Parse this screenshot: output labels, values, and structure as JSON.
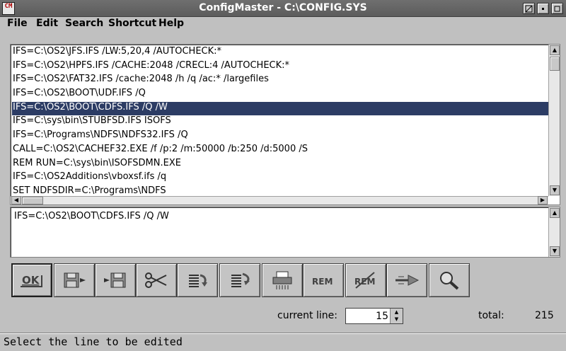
{
  "window": {
    "title": "ConfigMaster - C:\\CONFIG.SYS",
    "app_icon_text": "CM"
  },
  "menu": {
    "items": [
      "File",
      "Edit",
      "Search",
      "Shortcut",
      "Help"
    ]
  },
  "list": {
    "lines": [
      "IFS=C:\\OS2\\JFS.IFS /LW:5,20,4 /AUTOCHECK:*",
      "IFS=C:\\OS2\\HPFS.IFS /CACHE:2048 /CRECL:4 /AUTOCHECK:*",
      "IFS=C:\\OS2\\FAT32.IFS /cache:2048 /h /q /ac:* /largefiles",
      "IFS=C:\\OS2\\BOOT\\UDF.IFS /Q",
      "IFS=C:\\OS2\\BOOT\\CDFS.IFS /Q /W",
      "IFS=C:\\sys\\bin\\STUBFSD.IFS ISOFS",
      "IFS=C:\\Programs\\NDFS\\NDFS32.IFS /Q",
      "CALL=C:\\OS2\\CACHEF32.EXE /f /p:2 /m:50000 /b:250 /d:5000 /S",
      "REM RUN=C:\\sys\\bin\\ISOFSDMN.EXE",
      "IFS=C:\\OS2Additions\\vboxsf.ifs /q",
      "SET NDFSDIR=C:\\Programs\\NDFS"
    ],
    "selected_index": 4
  },
  "editor": {
    "text": "IFS=C:\\OS2\\BOOT\\CDFS.IFS /Q /W"
  },
  "toolbar": {
    "ok_label": "OK",
    "rem_label": "REM",
    "unrem_label": "REM"
  },
  "footer": {
    "current_line_label": "current line:",
    "current_line_value": "15",
    "total_label": "total:",
    "total_value": "215"
  },
  "status": {
    "text": "Select the line to be edited"
  },
  "colors": {
    "selection": "#2c3c64",
    "titlebar": "#666666"
  }
}
